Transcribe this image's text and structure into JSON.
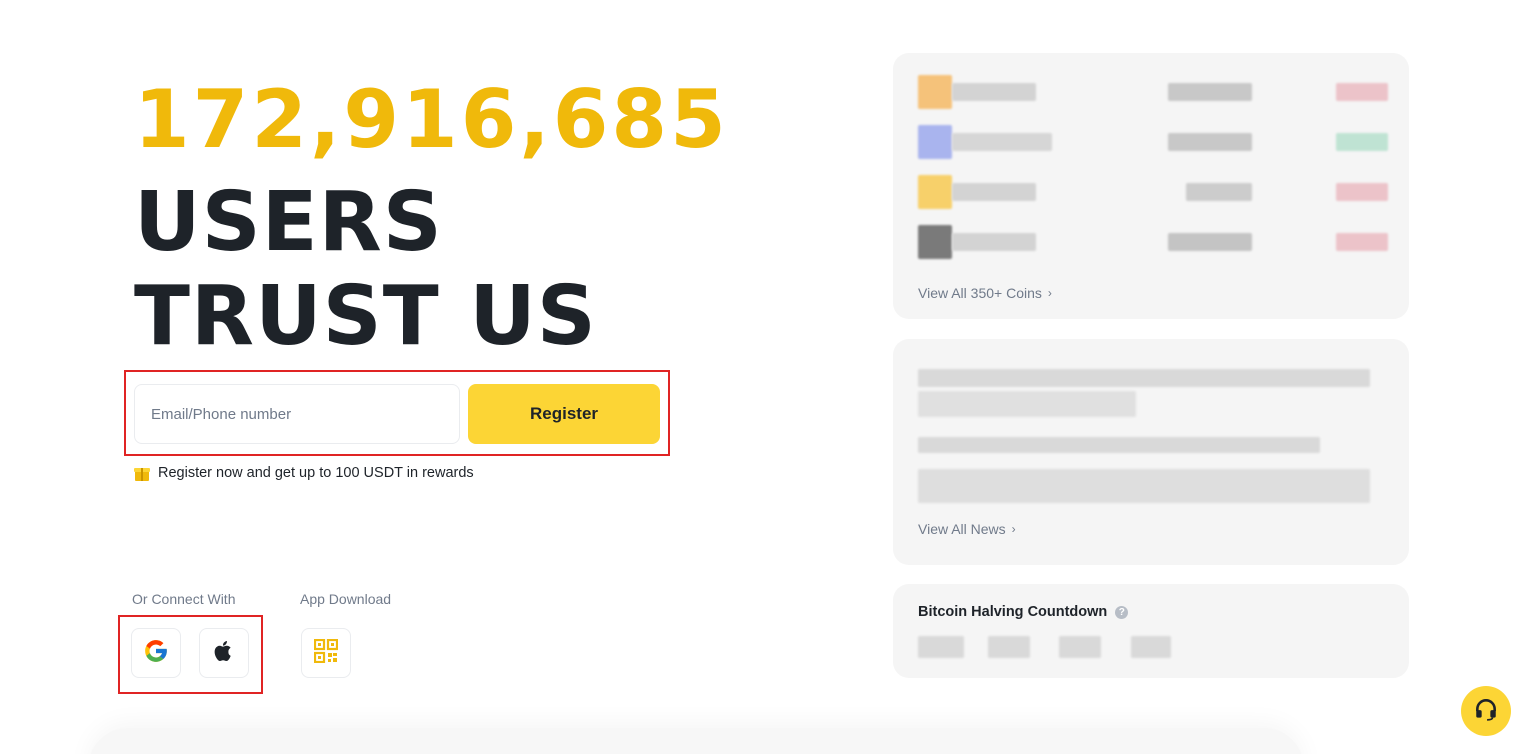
{
  "hero": {
    "user_count": "172,916,685",
    "line1": "USERS",
    "line2": "TRUST US"
  },
  "register": {
    "email_placeholder": "Email/Phone number",
    "button_label": "Register",
    "promo_text": "Register now and get up to 100 USDT in rewards"
  },
  "connect": {
    "label": "Or Connect With",
    "options": [
      "google-icon",
      "apple-icon"
    ]
  },
  "app_download": {
    "label": "App Download",
    "icon": "qr-code-icon"
  },
  "coins_card": {
    "view_all": "View All 350+ Coins"
  },
  "news_card": {
    "view_all": "View All News"
  },
  "halving_card": {
    "title": "Bitcoin Halving Countdown"
  },
  "colors": {
    "brand_yellow": "#fcd535",
    "count_yellow": "#f0b90b",
    "highlight_red": "#e02424",
    "text_dark": "#1e2329",
    "text_muted": "#707a8a"
  }
}
